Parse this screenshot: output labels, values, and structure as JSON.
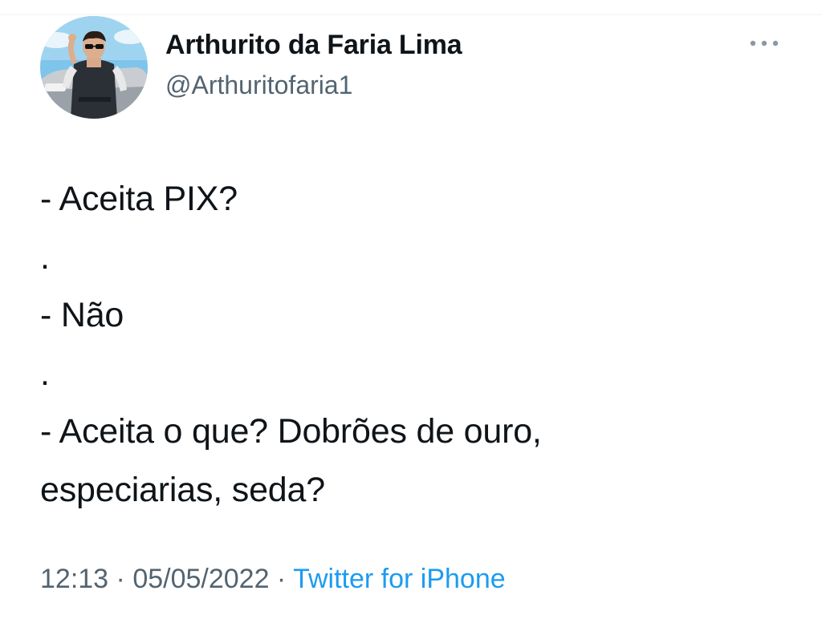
{
  "tweet": {
    "display_name": "Arthurito da Faria Lima",
    "handle": "@Arthuritofaria1",
    "more_icon": "more-horizontal-icon",
    "text_lines": [
      "- Aceita PIX?",
      ".",
      "- Não",
      ".",
      "- Aceita o que? Dobrões de ouro,",
      "especiarias, seda?"
    ],
    "time": "12:13",
    "separator": " · ",
    "date": "05/05/2022",
    "source": "Twitter for iPhone"
  },
  "colors": {
    "text_primary": "#0f1419",
    "text_secondary": "#536471",
    "link": "#1d9bf0"
  }
}
